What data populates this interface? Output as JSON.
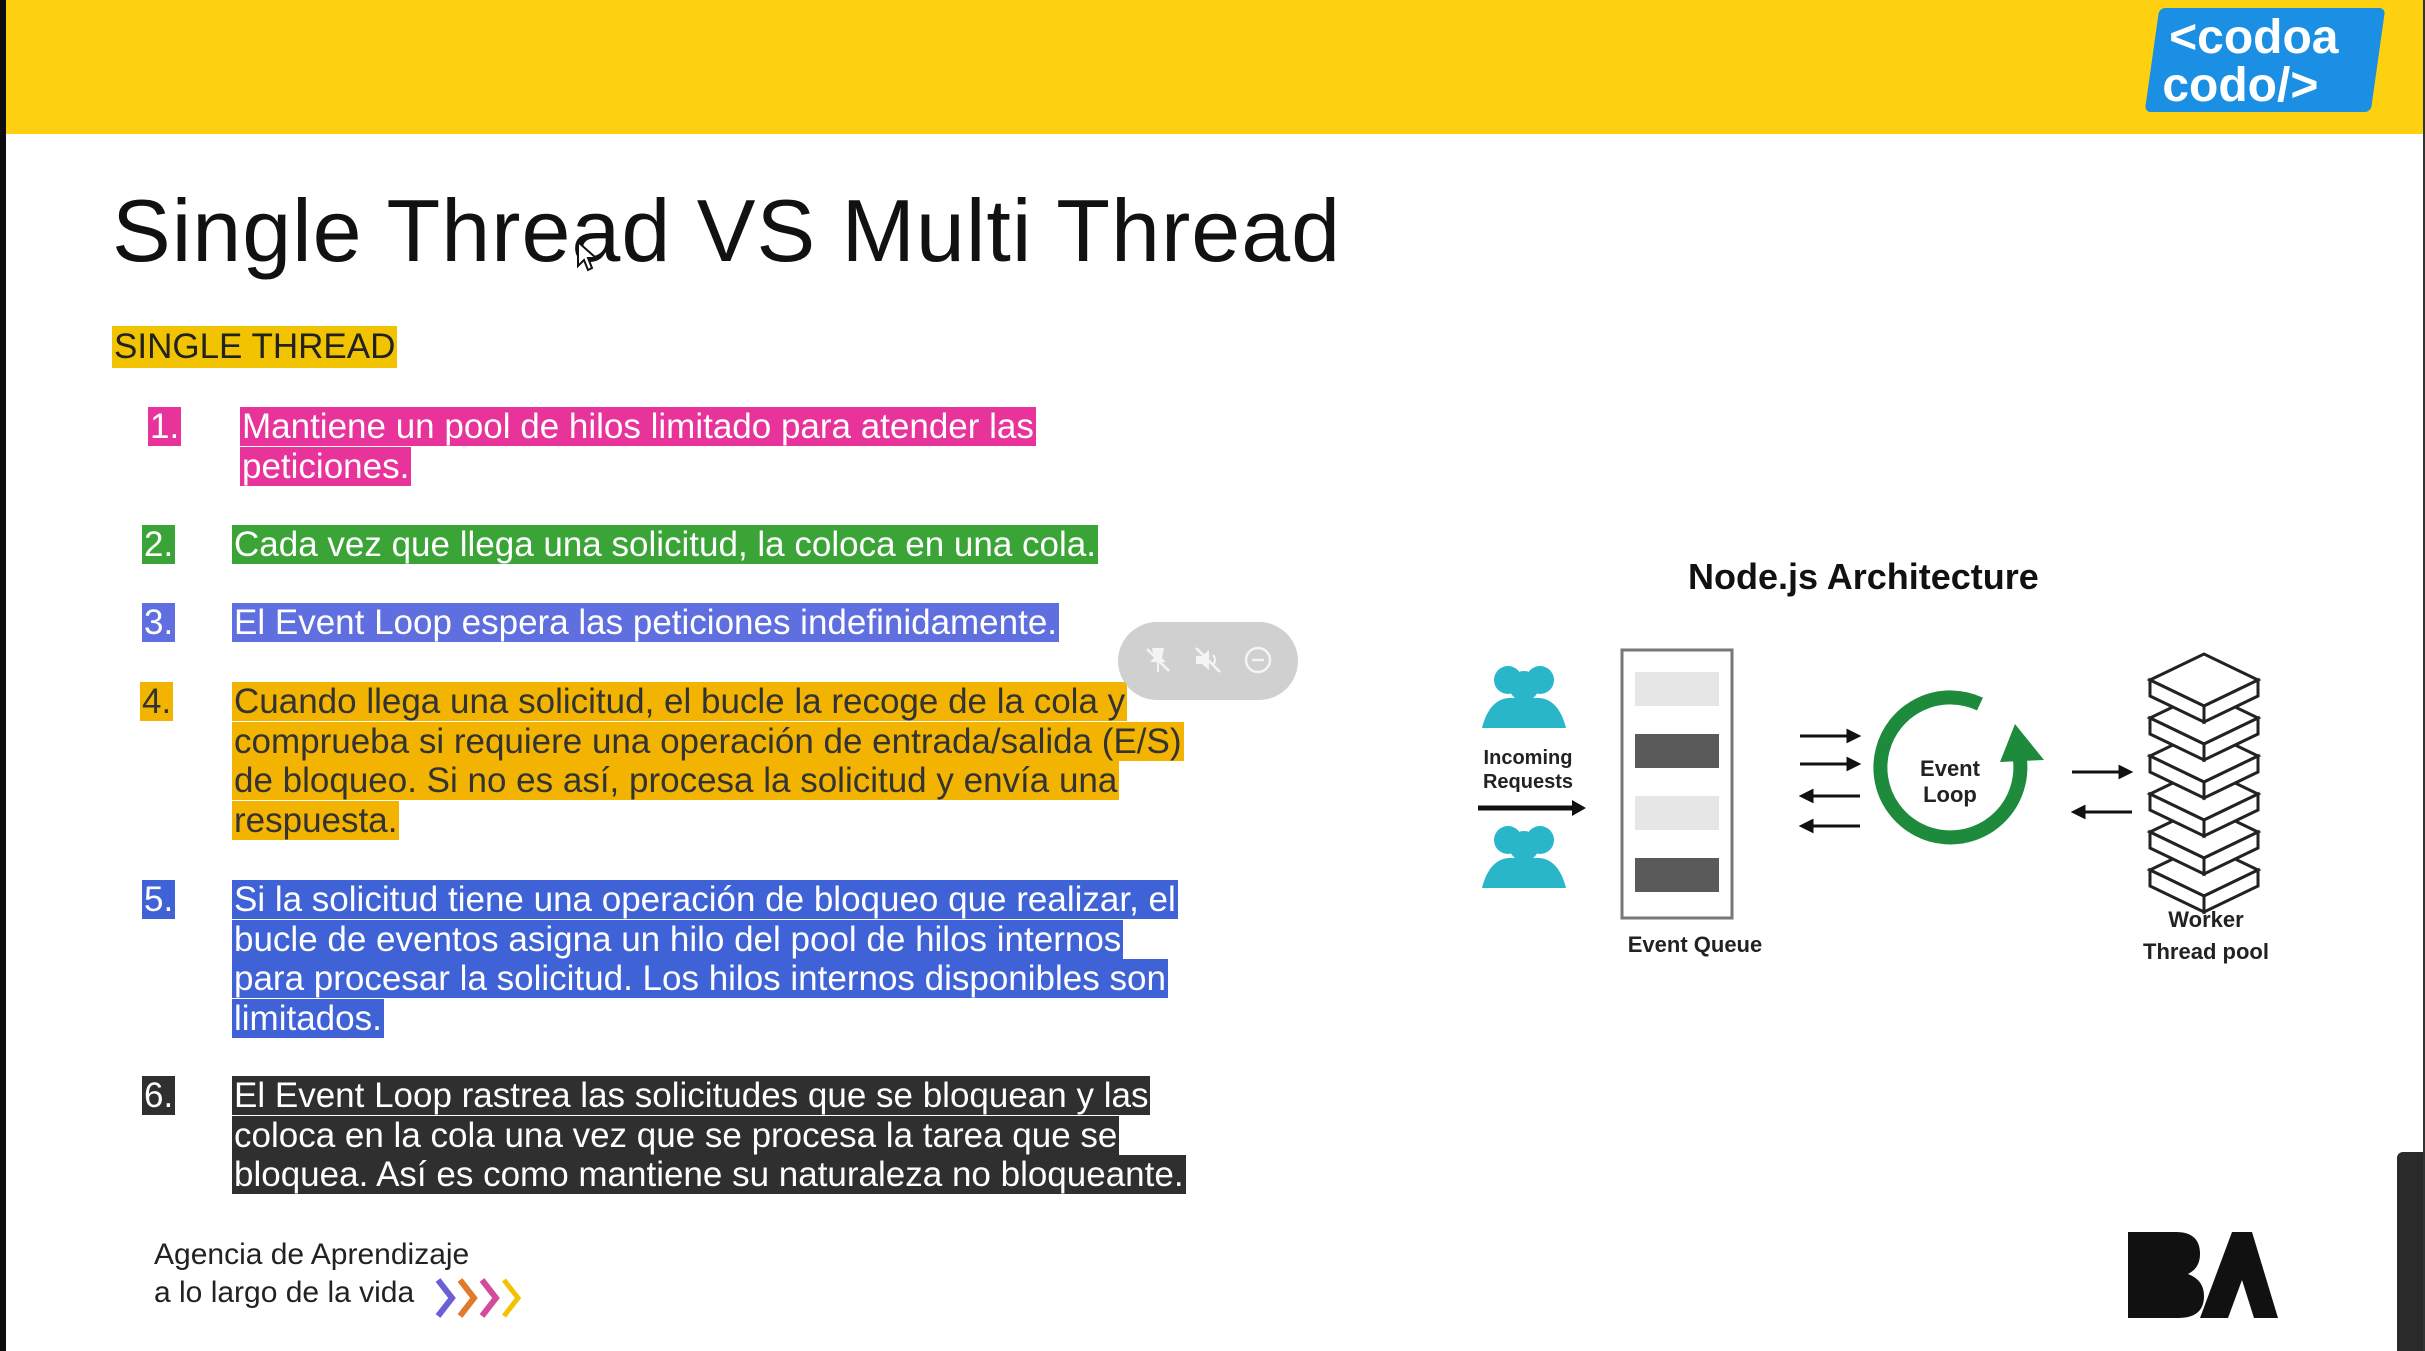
{
  "brand": {
    "logo_line1": "<codoa",
    "logo_line2": "codo/>"
  },
  "slide": {
    "title": "Single Thread VS Multi Thread",
    "section_label": "SINGLE THREAD",
    "items": [
      {
        "num": "1.",
        "lines": [
          "Mantiene un pool de hilos limitado para atender las",
          "peticiones."
        ]
      },
      {
        "num": "2.",
        "lines": [
          "Cada vez que llega una solicitud, la coloca en una cola."
        ]
      },
      {
        "num": "3.",
        "lines": [
          "El Event Loop espera las peticiones indefinidamente."
        ]
      },
      {
        "num": "4.",
        "lines": [
          "Cuando llega una solicitud, el bucle la recoge de la cola y",
          "comprueba si requiere una operación de entrada/salida (E/S)",
          "de bloqueo. Si no es así, procesa la solicitud y envía una",
          "respuesta."
        ]
      },
      {
        "num": "5.",
        "lines": [
          "Si la solicitud tiene una operación de bloqueo que realizar, el",
          "bucle de eventos asigna un hilo del pool de hilos internos",
          "para procesar la solicitud. Los hilos internos disponibles son",
          "limitados."
        ]
      },
      {
        "num": "6.",
        "lines": [
          "El Event Loop rastrea las solicitudes que se bloquean y las",
          "coloca en la cola una vez que se procesa la tarea que se",
          "bloquea. Así es como mantiene su naturaleza no bloqueante."
        ]
      }
    ]
  },
  "diagram": {
    "title": "Node.js Architecture",
    "incoming_line1": "Incoming",
    "incoming_line2": "Requests",
    "event_queue": "Event Queue",
    "event_loop_line1": "Event",
    "event_loop_line2": "Loop",
    "worker_line1": "Worker",
    "worker_line2": "Thread pool",
    "colors": {
      "people": "#29b6c8",
      "loop": "#1d8a3c",
      "queue_dark": "#5a5a5a",
      "queue_light": "#e6e6e6"
    }
  },
  "overlay": {
    "icons": [
      "pin-off-icon",
      "volume-off-icon",
      "minus-circle-icon"
    ]
  },
  "footer": {
    "agency_line1": "Agencia de Aprendizaje",
    "agency_line2": "a lo largo de la vida",
    "ba_logo": "BA"
  }
}
